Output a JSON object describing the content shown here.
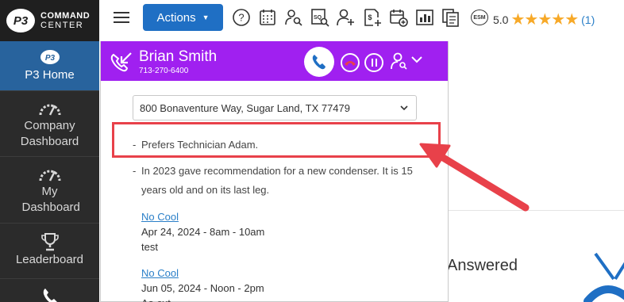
{
  "app": {
    "logo_mark": "P3",
    "logo_line1": "COMMAND",
    "logo_line2": "CENTER"
  },
  "sidebar": {
    "items": [
      {
        "label": "P3 Home",
        "icon": "p3-logo-icon",
        "active": true
      },
      {
        "label": "Company Dashboard",
        "icon": "gauge-icon",
        "active": false
      },
      {
        "label": "My Dashboard",
        "icon": "gauge-icon",
        "active": false
      },
      {
        "label": "Leaderboard",
        "icon": "trophy-icon",
        "active": false
      },
      {
        "label": "",
        "icon": "phone-icon",
        "active": false
      }
    ]
  },
  "topbar": {
    "actions_label": "Actions",
    "icons": [
      "help-icon",
      "calendar-icon",
      "customer-search-icon",
      "sq-search-icon",
      "add-user-icon",
      "add-invoice-icon",
      "add-calendar-icon",
      "bar-chart-icon",
      "copy-icon"
    ],
    "esm_label": "ESM",
    "rating_value": "5.0",
    "rating_stars": "★★★★★",
    "rating_count": "(1)"
  },
  "call": {
    "caller_name": "Brian Smith",
    "caller_phone": "713-270-6400",
    "address": "800 Bonaventure Way, Sugar Land, TX 77479",
    "notes": [
      "Prefers Technician Adam.",
      "In 2023 gave recommendation for a new condenser. It is 15 years old and on its last leg."
    ],
    "appointments": [
      {
        "type": "No Cool",
        "when": "Apr 24, 2024 - 8am - 10am",
        "note": "test"
      },
      {
        "type": "No Cool",
        "when": "Jun 05, 2024 - Noon - 2pm",
        "note": "Aa cut"
      }
    ]
  },
  "background": {
    "answered_label": "Answered"
  },
  "colors": {
    "sidebar_bg": "#2b2b2b",
    "sidebar_active": "#28639d",
    "actions_btn": "#1f6fc4",
    "call_header": "#a020f0",
    "annotation_red": "#e8414a",
    "star": "#f7a928",
    "link": "#2a7fc8"
  }
}
